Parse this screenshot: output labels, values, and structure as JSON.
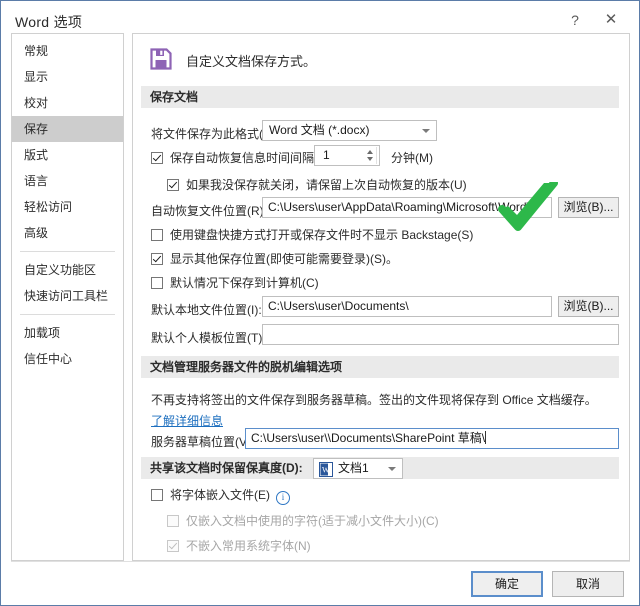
{
  "window": {
    "title": "Word 选项",
    "help_label": "?",
    "close_label": "✕"
  },
  "sidebar": {
    "items": [
      {
        "label": "常规",
        "selected": false
      },
      {
        "label": "显示",
        "selected": false
      },
      {
        "label": "校对",
        "selected": false
      },
      {
        "label": "保存",
        "selected": true
      },
      {
        "label": "版式",
        "selected": false
      },
      {
        "label": "语言",
        "selected": false
      },
      {
        "label": "轻松访问",
        "selected": false
      },
      {
        "label": "高级",
        "selected": false
      },
      {
        "label": "自定义功能区",
        "selected": false
      },
      {
        "label": "快速访问工具栏",
        "selected": false
      },
      {
        "label": "加载项",
        "selected": false
      },
      {
        "label": "信任中心",
        "selected": false
      }
    ]
  },
  "panel": {
    "header_text": "自定义文档保存方式。",
    "header_icon": "save-floppy-icon",
    "sections": {
      "save_documents": {
        "title": "保存文档",
        "format_label": "将文件保存为此格式(F):",
        "format_value": "Word 文档 (*.docx)",
        "autorecover_checkbox": "保存自动恢复信息时间间隔(A)",
        "autorecover_checked": true,
        "autorecover_minutes": "1",
        "minutes_label": "分钟(M)",
        "keep_last_checkbox": "如果我没保存就关闭，请保留上次自动恢复的版本(U)",
        "keep_last_checked": true,
        "autorecover_path_label": "自动恢复文件位置(R):",
        "autorecover_path_value": "C:\\Users\\user\\AppData\\Roaming\\Microsoft\\Word\\",
        "browse_1": "浏览(B)...",
        "no_backstage_checkbox": "使用键盘快捷方式打开或保存文件时不显示 Backstage(S)",
        "no_backstage_checked": false,
        "show_other_locations_checkbox": "显示其他保存位置(即使可能需要登录)(S)。",
        "show_other_locations_checked": true,
        "save_to_computer_checkbox": "默认情况下保存到计算机(C)",
        "save_to_computer_checked": false,
        "local_path_label": "默认本地文件位置(I):",
        "local_path_value": "C:\\Users\\user\\Documents\\",
        "browse_2": "浏览(B)...",
        "template_path_label": "默认个人模板位置(T):",
        "template_path_value": ""
      },
      "offline_editing": {
        "title": "文档管理服务器文件的脱机编辑选项",
        "description": "不再支持将签出的文件保存到服务器草稿。签出的文件现将保存到 Office 文档缓存。",
        "link_text": "了解详细信息",
        "server_draft_label": "服务器草稿位置(V):",
        "server_draft_value": "C:\\Users\\user\\\\Documents\\SharePoint 草稿\\"
      },
      "fidelity": {
        "title": "共享该文档时保留保真度(D):",
        "document_value": "文档1",
        "document_icon": "word-document-icon",
        "embed_fonts_checkbox": "将字体嵌入文件(E)",
        "embed_fonts_checked": false,
        "embed_fonts_info_icon": "info-circle-icon",
        "embed_used_only_checkbox": "仅嵌入文档中使用的字符(适于减小文件大小)(C)",
        "embed_used_only_checked": false,
        "embed_used_only_disabled": true,
        "no_common_fonts_checkbox": "不嵌入常用系统字体(N)",
        "no_common_fonts_checked": true,
        "no_common_fonts_disabled": true
      }
    }
  },
  "footer": {
    "ok_label": "确定",
    "cancel_label": "取消"
  },
  "annotation": {
    "check_icon": "green-checkmark-annotation",
    "color": "#2db84a"
  },
  "colors": {
    "accent": "#5b8ecb",
    "floppy": "#8e63b5",
    "selected_row": "#cdcdcd",
    "section_header": "#eaeaea",
    "link": "#1d6fbf"
  }
}
